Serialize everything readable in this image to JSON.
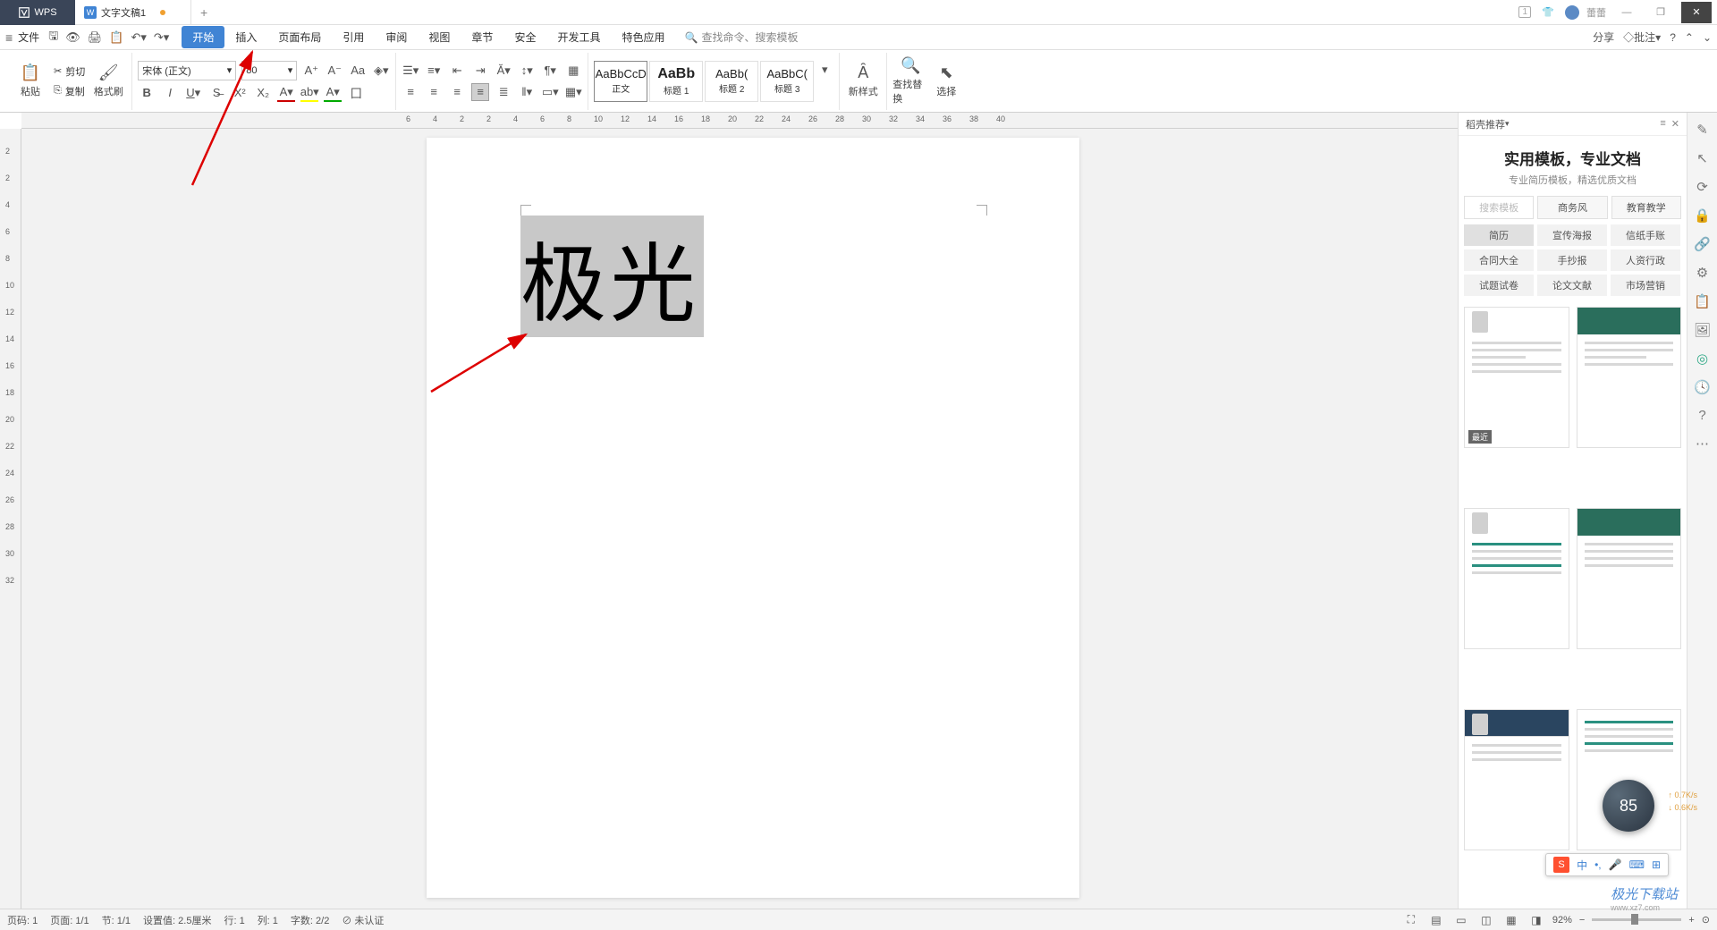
{
  "titlebar": {
    "app": "WPS",
    "doc_tab": "文字文稿1",
    "add": "+",
    "badge_num": "1",
    "username": "蕾蕾"
  },
  "menubar": {
    "file": "文件",
    "tabs": [
      "开始",
      "插入",
      "页面布局",
      "引用",
      "审阅",
      "视图",
      "章节",
      "安全",
      "开发工具",
      "特色应用"
    ],
    "searchcmd": "查找命令、搜索模板",
    "share": "分享",
    "comment": "批注"
  },
  "ribbon": {
    "paste": "粘贴",
    "cut": "剪切",
    "copy": "复制",
    "formatpainter": "格式刷",
    "font_name": "宋体 (正文)",
    "font_size": "80",
    "styles": [
      {
        "preview": "AaBbCcD",
        "name": "正文"
      },
      {
        "preview": "AaBb",
        "name": "标题 1"
      },
      {
        "preview": "AaBb(",
        "name": "标题 2"
      },
      {
        "preview": "AaBbC(",
        "name": "标题 3"
      }
    ],
    "newstyle": "新样式",
    "findreplace": "查找替换",
    "select": "选择"
  },
  "document": {
    "text": "极光"
  },
  "rpanel": {
    "header": "稻壳推荐",
    "title": "实用模板，专业文档",
    "subtitle": "专业简历模板，精选优质文档",
    "tabs": [
      "搜索模板",
      "商务风",
      "教育教学"
    ],
    "cats": [
      "简历",
      "宣传海报",
      "信纸手账",
      "合同大全",
      "手抄报",
      "人资行政",
      "试题试卷",
      "论文文献",
      "市场营销"
    ],
    "recent_badge": "最近"
  },
  "statusbar": {
    "page_ord": "页码: 1",
    "page": "页面: 1/1",
    "section": "节: 1/1",
    "setval": "设置值: 2.5厘米",
    "line": "行: 1",
    "col": "列: 1",
    "words": "字数: 2/2",
    "auth": "未认证",
    "zoom": "92%"
  },
  "float": {
    "circle": "85",
    "speed_up": "0.7K/s",
    "speed_dn": "0.6K/s",
    "ime_logo": "S",
    "ime_items": [
      "中",
      "•,",
      "🎤",
      "⌨",
      "⊞"
    ]
  },
  "watermark": {
    "main": "极光下载站",
    "sub": "www.xz7.com"
  },
  "hruler_marks": [
    "6",
    "4",
    "2",
    "2",
    "4",
    "6",
    "8",
    "10",
    "12",
    "14",
    "16",
    "18",
    "20",
    "22",
    "24",
    "26",
    "28",
    "30",
    "32",
    "34",
    "36",
    "38",
    "40"
  ],
  "vruler_marks": [
    "2",
    "2",
    "4",
    "6",
    "8",
    "10",
    "12",
    "14",
    "16",
    "18",
    "20",
    "22",
    "24",
    "26",
    "28",
    "30",
    "32"
  ]
}
